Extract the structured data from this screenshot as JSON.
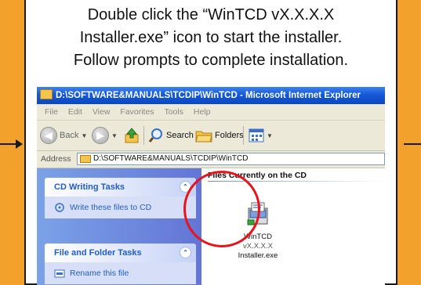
{
  "instructions": {
    "line1": "Double click the “WinTCD vX.X.X.X",
    "line2": "Installer.exe” icon to start the installer.",
    "line3": "Follow prompts to complete installation."
  },
  "window": {
    "title": "D:\\SOFTWARE&MANUALS\\TCDIP\\WinTCD - Microsoft Internet Explorer"
  },
  "menu": [
    "File",
    "Edit",
    "View",
    "Favorites",
    "Tools",
    "Help"
  ],
  "toolbar": {
    "back_label": "Back",
    "search_label": "Search",
    "folders_label": "Folders"
  },
  "address": {
    "label": "Address",
    "value": "D:\\SOFTWARE&MANUALS\\TCDIP\\WinTCD"
  },
  "left_pane": {
    "cd_tasks_title": "CD Writing Tasks",
    "cd_task_item": "Write these files to CD",
    "file_tasks_title": "File and Folder Tasks",
    "file_task_item": "Rename this file"
  },
  "files": {
    "header": "Files Currently on the CD",
    "installer_name_1": "WinTCD",
    "installer_version": "vX.X.X.X",
    "installer_name_2": "Installer.exe"
  },
  "colors": {
    "background": "#f2a22c",
    "highlight": "#e8141b",
    "xp_title": "#0a47c4"
  }
}
